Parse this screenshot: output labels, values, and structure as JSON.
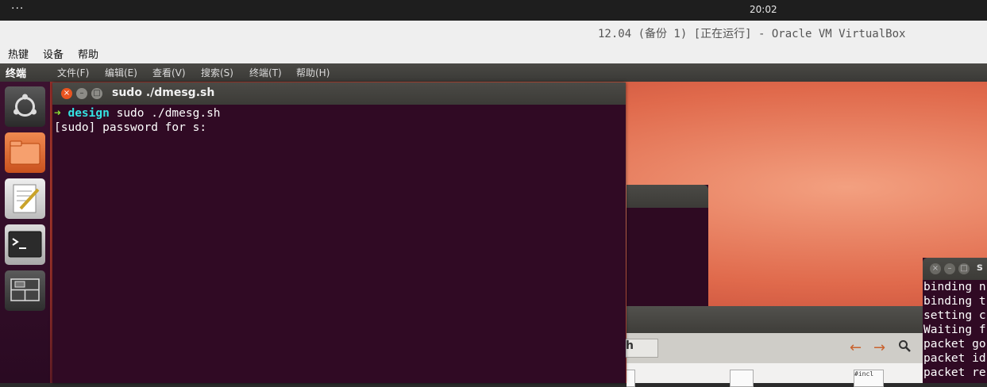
{
  "topbar": {
    "menu_dots": "···",
    "clock": "20:02"
  },
  "vbox": {
    "title": "12.04 (备份 1) [正在运行] - Oracle VM VirtualBox",
    "menu": [
      "热键",
      "设备",
      "帮助"
    ]
  },
  "panel": {
    "app_name": "终端",
    "menu": [
      "文件(F)",
      "编辑(E)",
      "查看(V)",
      "搜索(S)",
      "终端(T)",
      "帮助(H)"
    ]
  },
  "launcher": {
    "items": [
      {
        "name": "dash-home",
        "icon": "ubuntu-logo-icon"
      },
      {
        "name": "files",
        "icon": "folder-icon"
      },
      {
        "name": "text-editor",
        "icon": "text-editor-icon"
      },
      {
        "name": "terminal",
        "icon": "terminal-icon"
      },
      {
        "name": "workspace-switcher",
        "icon": "workspace-switcher-icon"
      }
    ]
  },
  "terminal": {
    "title": "sudo ./dmesg.sh",
    "prompt_arrow": "➜",
    "prompt_dir": "design",
    "command": "sudo ./dmesg.sh",
    "line2": "[sudo] password for s:"
  },
  "nautilus": {
    "location_fragment": "h",
    "back_icon": "←",
    "forward_icon": "→",
    "file_label": "#incl"
  },
  "small_terminal": {
    "title_fragment": "s",
    "lines": [
      "binding n",
      "binding t",
      "setting c",
      "Waiting f",
      "packet go",
      "packet id",
      "packet re"
    ]
  },
  "colors": {
    "prompt_arrow": "#8ae234",
    "prompt_dir": "#34e2e2",
    "terminal_bg": "#300a24",
    "close_button": "#e95420"
  }
}
